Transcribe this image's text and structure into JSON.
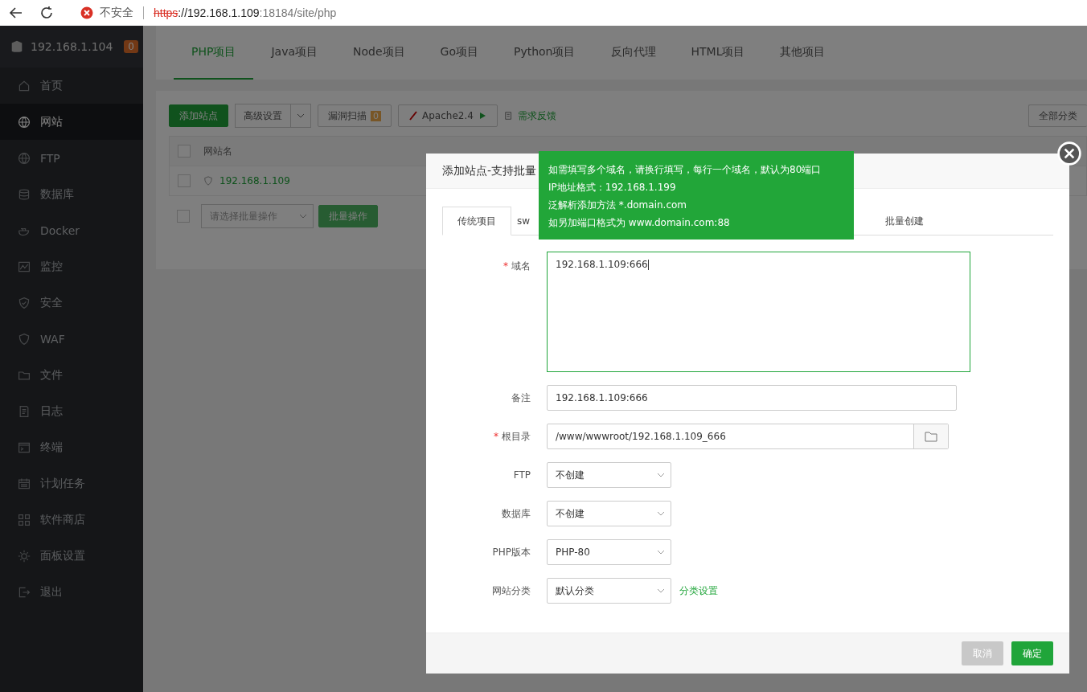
{
  "browser": {
    "security": "不安全",
    "url_scheme": "https",
    "url_host": "://192.168.1.109",
    "url_rest": ":18184/site/php"
  },
  "sidebar": {
    "server": "192.168.1.104",
    "badge": "0",
    "items": [
      {
        "label": "首页",
        "selected": false
      },
      {
        "label": "网站",
        "selected": true
      },
      {
        "label": "FTP",
        "selected": false
      },
      {
        "label": "数据库",
        "selected": false
      },
      {
        "label": "Docker",
        "selected": false
      },
      {
        "label": "监控",
        "selected": false
      },
      {
        "label": "安全",
        "selected": false
      },
      {
        "label": "WAF",
        "selected": false
      },
      {
        "label": "文件",
        "selected": false
      },
      {
        "label": "日志",
        "selected": false
      },
      {
        "label": "终端",
        "selected": false
      },
      {
        "label": "计划任务",
        "selected": false
      },
      {
        "label": "软件商店",
        "selected": false
      },
      {
        "label": "面板设置",
        "selected": false
      },
      {
        "label": "退出",
        "selected": false
      }
    ]
  },
  "tabs": [
    {
      "label": "PHP项目",
      "selected": true
    },
    {
      "label": "Java项目",
      "selected": false
    },
    {
      "label": "Node项目",
      "selected": false
    },
    {
      "label": "Go项目",
      "selected": false
    },
    {
      "label": "Python项目",
      "selected": false
    },
    {
      "label": "反向代理",
      "selected": false
    },
    {
      "label": "HTML项目",
      "selected": false
    },
    {
      "label": "其他项目",
      "selected": false
    }
  ],
  "toolbar": {
    "add_site": "添加站点",
    "advanced": "高级设置",
    "scan": "漏洞扫描",
    "scan_badge": "0",
    "apache": "Apache2.4",
    "feedback": "需求反馈",
    "category": "全部分类"
  },
  "table": {
    "header_checked": false,
    "columns": [
      "网站名"
    ],
    "rows": [
      {
        "name": "192.168.1.109",
        "selected": false
      }
    ]
  },
  "batch": {
    "checked": false,
    "placeholder": "请选择批量操作",
    "button": "批量操作"
  },
  "dialog": {
    "title": "添加站点-支持批量",
    "tabs": [
      {
        "label": "传统项目",
        "selected": true
      },
      {
        "label": "sw",
        "selected": false
      },
      {
        "label": "批量创建",
        "selected": false
      }
    ],
    "tooltip": [
      "如需填写多个域名，请换行填写，每行一个域名，默认为80端口",
      "IP地址格式：192.168.1.199",
      "泛解析添加方法 *.domain.com",
      "如另加端口格式为 www.domain.com:88"
    ],
    "fields": [
      {
        "kind": "textarea",
        "mark": "*",
        "label": "域名",
        "value": "192.168.1.109:666"
      },
      {
        "kind": "input",
        "label": "备注",
        "value": "192.168.1.109:666"
      },
      {
        "kind": "path",
        "mark": "*",
        "label": "根目录",
        "value": "/www/wwwroot/192.168.1.109_666"
      },
      {
        "kind": "select",
        "label": "FTP",
        "value": "不创建"
      },
      {
        "kind": "select",
        "label": "数据库",
        "value": "不创建"
      },
      {
        "kind": "select",
        "label": "PHP版本",
        "value": "PHP-80"
      },
      {
        "kind": "select",
        "label": "网站分类",
        "value": "默认分类",
        "link": "分类设置"
      }
    ],
    "cancel": "取消",
    "confirm": "确定"
  }
}
